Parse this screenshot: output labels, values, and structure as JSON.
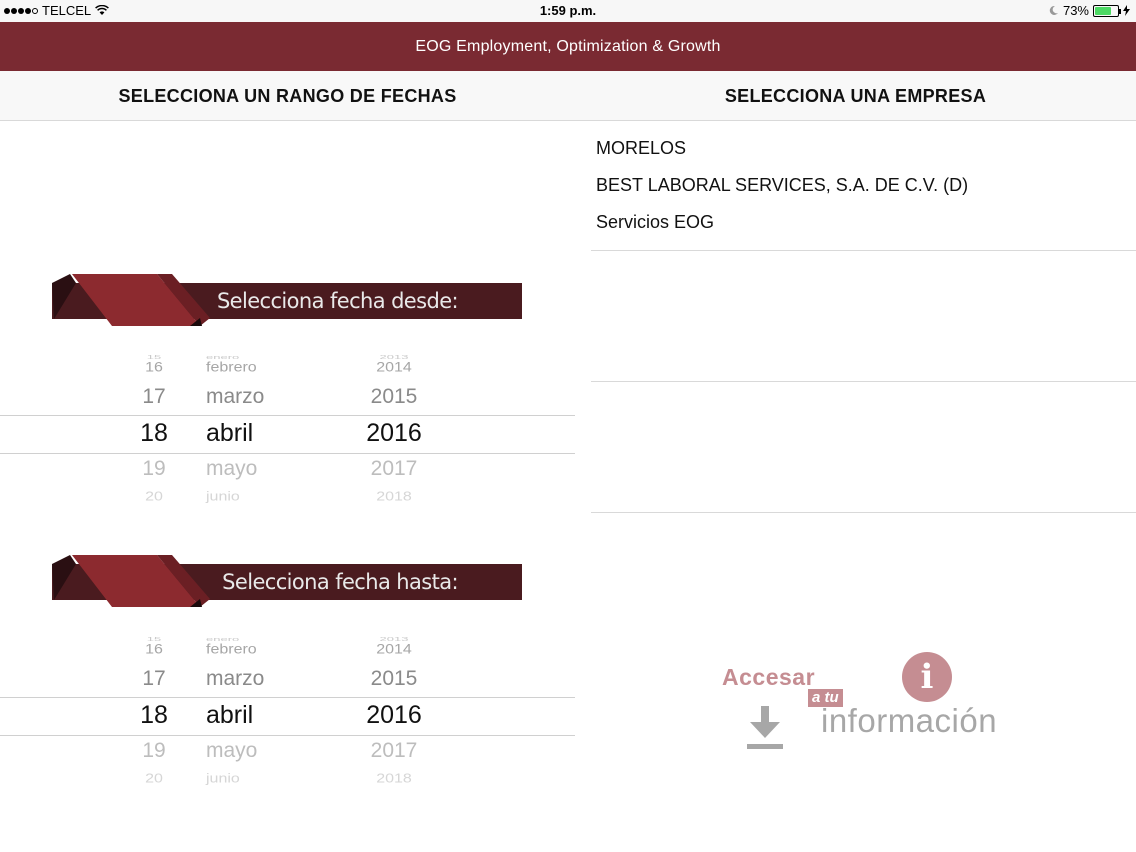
{
  "status_bar": {
    "carrier": "TELCEL",
    "time": "1:59 p.m.",
    "battery": "73%",
    "battery_level": 0.73
  },
  "app": {
    "title": "EOG Employment, Optimization & Growth"
  },
  "sections": {
    "dates_title": "SELECCIONA UN RANGO DE FECHAS",
    "company_title": "SELECCIONA UNA EMPRESA"
  },
  "companies": [
    "MORELOS",
    "BEST LABORAL SERVICES, S.A. DE C.V. (D)",
    "Servicios EOG"
  ],
  "from_picker": {
    "banner": "Selecciona fecha desde:",
    "rows": [
      {
        "day": "15",
        "month": "enero",
        "year": "2013"
      },
      {
        "day": "16",
        "month": "febrero",
        "year": "2014"
      },
      {
        "day": "17",
        "month": "marzo",
        "year": "2015"
      },
      {
        "day": "18",
        "month": "abril",
        "year": "2016"
      },
      {
        "day": "19",
        "month": "mayo",
        "year": "2017"
      },
      {
        "day": "20",
        "month": "junio",
        "year": "2018"
      }
    ]
  },
  "to_picker": {
    "banner": "Selecciona fecha hasta:",
    "rows": [
      {
        "day": "15",
        "month": "enero",
        "year": "2013"
      },
      {
        "day": "16",
        "month": "febrero",
        "year": "2014"
      },
      {
        "day": "17",
        "month": "marzo",
        "year": "2015"
      },
      {
        "day": "18",
        "month": "abril",
        "year": "2016"
      },
      {
        "day": "19",
        "month": "mayo",
        "year": "2017"
      },
      {
        "day": "20",
        "month": "junio",
        "year": "2018"
      }
    ]
  },
  "logo": {
    "line1": "Accesar",
    "line2": "a tu",
    "line3": "información",
    "info_glyph": "i",
    "icons": [
      "info-icon",
      "download-icon"
    ]
  },
  "colors": {
    "header": "#7a2a32",
    "banner_dark": "#4a1b1f",
    "banner_ribbon": "#8c2a2f",
    "logo_accent": "#c58d92"
  }
}
